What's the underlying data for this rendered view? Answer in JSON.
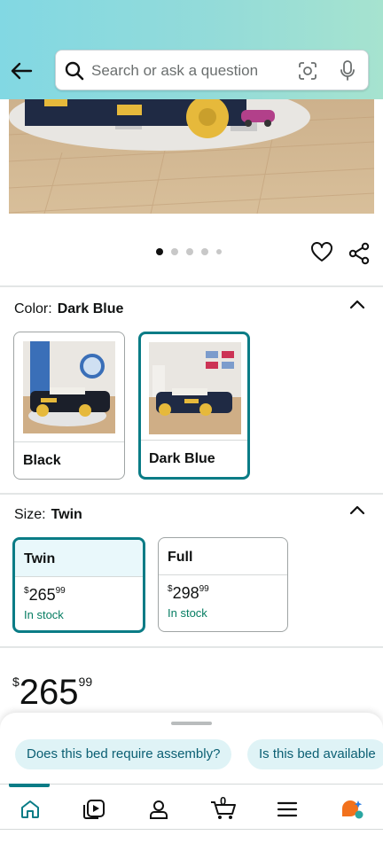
{
  "search": {
    "placeholder": "Search or ask a question"
  },
  "icons": [
    "back-arrow-icon",
    "search-icon",
    "camera-lens-icon",
    "microphone-icon",
    "heart-icon",
    "share-icon",
    "chevron-up-icon",
    "home-icon",
    "video-icon",
    "account-icon",
    "cart-icon",
    "menu-icon",
    "rufus-icon"
  ],
  "colors": {
    "accent": "#0a7c86",
    "in_stock": "#067d62",
    "header_left": "#82d8e3",
    "header_right": "#a6e3cf"
  },
  "gallery": {
    "image_count": 5,
    "active_index": 0
  },
  "color_option": {
    "label": "Color:",
    "selected": "Dark Blue",
    "swatches": [
      {
        "name": "Black"
      },
      {
        "name": "Dark Blue"
      }
    ]
  },
  "size_option": {
    "label": "Size:",
    "selected": "Twin",
    "sizes": [
      {
        "name": "Twin",
        "currency": "$",
        "whole": "265",
        "fraction": "99",
        "stock": "In stock"
      },
      {
        "name": "Full",
        "currency": "$",
        "whole": "298",
        "fraction": "99",
        "stock": "In stock"
      }
    ]
  },
  "price": {
    "currency": "$",
    "whole": "265",
    "fraction": "99"
  },
  "suggestions": [
    "Does this bed require assembly?",
    "Is this bed available"
  ],
  "cart": {
    "count": "0"
  }
}
